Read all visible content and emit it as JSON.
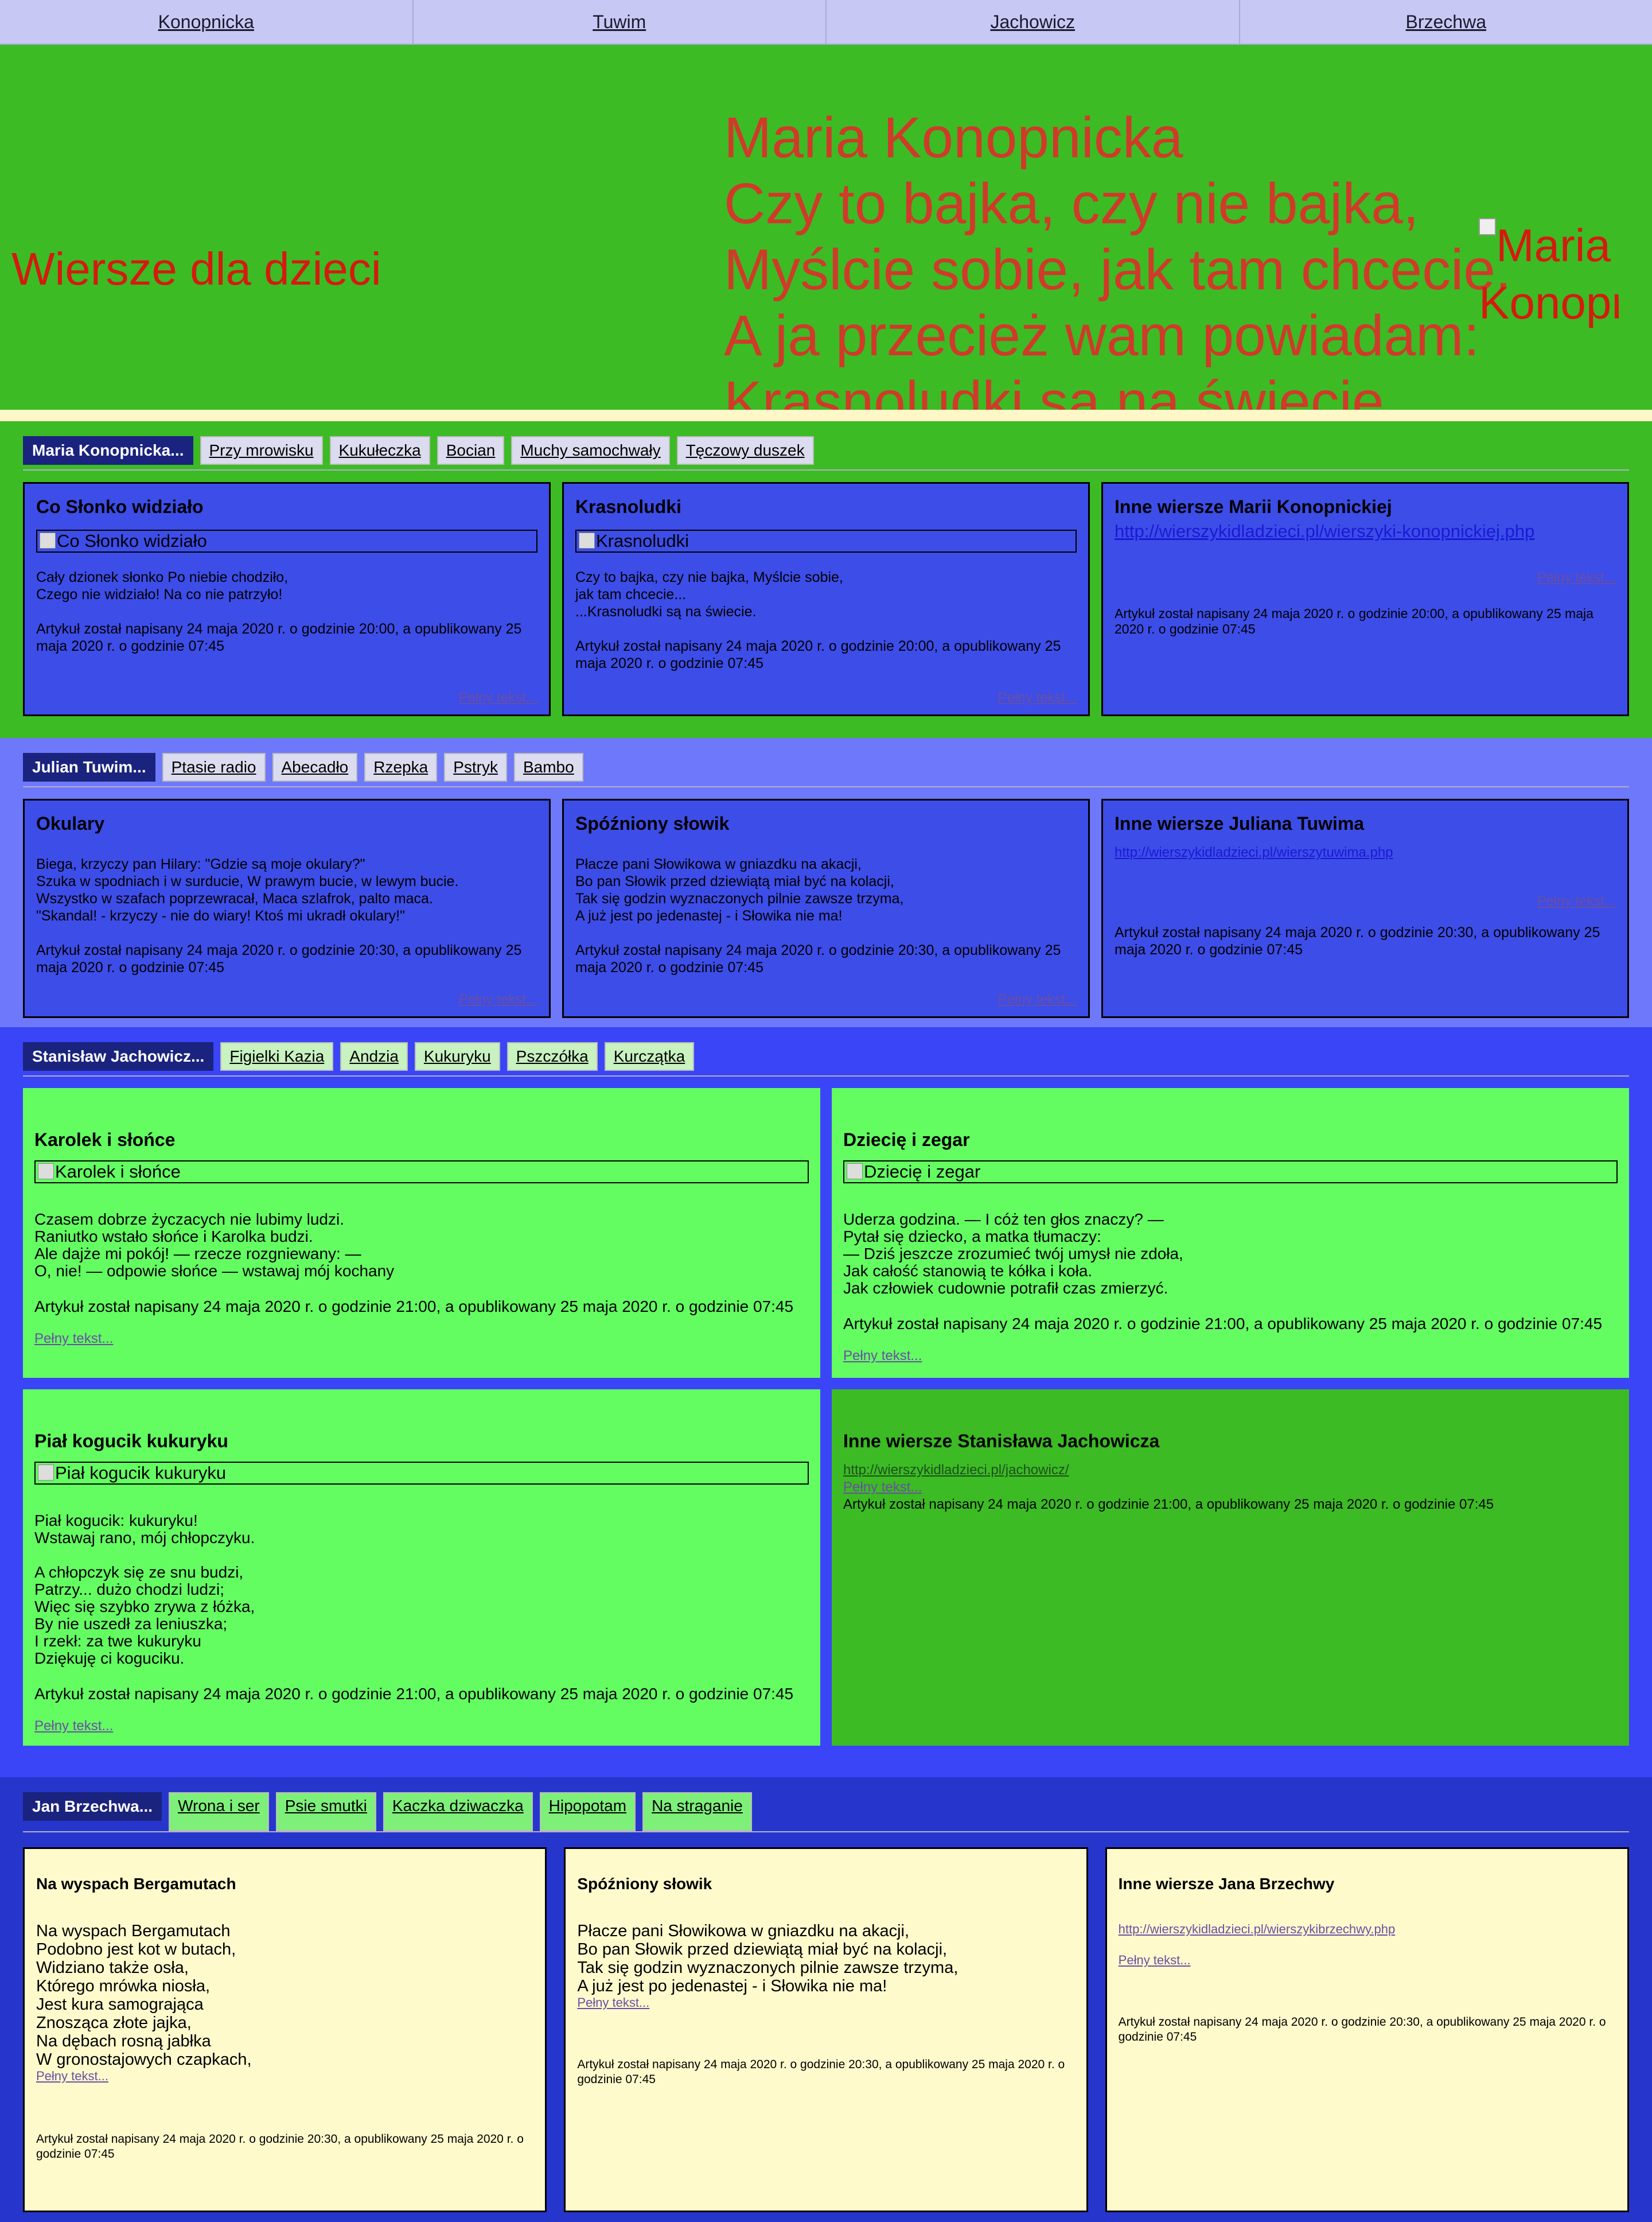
{
  "nav": [
    "Konopnicka",
    "Tuwim",
    "Jachowicz",
    "Brzechwa"
  ],
  "banner": {
    "site_title": "Wiersze dla dzieci",
    "quote": [
      "Maria Konopnicka",
      "Czy to bajka, czy nie bajka,",
      "Myślcie sobie, jak tam chcecie.",
      "A ja przecież wam powiadam:",
      "Krasnoludki są na świecie..."
    ],
    "portrait_alt": "Maria Konopnicka"
  },
  "konopnicka": {
    "author": "Maria Konopnicka...",
    "tabs": [
      "Przy mrowisku",
      "Kukułeczka",
      "Bocian",
      "Muchy samochwały",
      "Tęczowy duszek"
    ],
    "cards": [
      {
        "title": "Co Słonko widziało",
        "img_alt": "Co Słonko widziało",
        "text": [
          "Cały dzionek słonko Po niebie chodziło,",
          "Czego nie widziało! Na co nie patrzyło!"
        ],
        "meta": "Artykuł został napisany 24 maja 2020 r. o godzinie 20:00, a opublikowany 25 maja 2020 r. o godzinie 07:45",
        "more": "Pełny tekst..."
      },
      {
        "title": "Krasnoludki",
        "img_alt": "Krasnoludki",
        "text": [
          "Czy to bajka, czy nie bajka, Myślcie sobie,",
          "jak tam chcecie...",
          "...Krasnoludki są na świecie."
        ],
        "meta": "Artykuł został napisany 24 maja 2020 r. o godzinie 20:00, a opublikowany 25 maja 2020 r. o godzinie 07:45",
        "more": "Pełny tekst..."
      },
      {
        "title": "Inne wiersze Marii Konopnickiej",
        "link": "http://wierszykidladzieci.pl/wierszyki-konopnickiej.php",
        "more": "Pełny tekst...",
        "meta": "Artykuł został napisany 24 maja 2020 r. o godzinie 20:00, a opublikowany 25 maja 2020 r. o godzinie 07:45"
      }
    ]
  },
  "tuwim": {
    "author": "Julian Tuwim...",
    "tabs": [
      "Ptasie radio",
      "Abecadło",
      "Rzepka",
      "Pstryk",
      "Bambo"
    ],
    "cards": [
      {
        "title": "Okulary",
        "text": [
          "Biega, krzyczy pan Hilary: \"Gdzie są moje okulary?\"",
          "Szuka w spodniach i w surducie, W prawym bucie, w lewym bucie.",
          "Wszystko w szafach poprzewracał, Maca szlafrok, palto maca.",
          "\"Skandal! - krzyczy - nie do wiary! Ktoś mi ukradł okulary!\""
        ],
        "meta": "Artykuł został napisany 24 maja 2020 r. o godzinie 20:30, a opublikowany 25 maja 2020 r. o godzinie 07:45",
        "more": "Pełny tekst..."
      },
      {
        "title": "Spóźniony słowik",
        "text": [
          "Płacze pani Słowikowa w gniazdku na akacji,",
          "Bo pan Słowik przed dziewiątą miał być na kolacji,",
          "Tak się godzin wyznaczonych pilnie zawsze trzyma,",
          "A już jest po jedenastej - i Słowika nie ma!"
        ],
        "meta": "Artykuł został napisany 24 maja 2020 r. o godzinie 20:30, a opublikowany 25 maja 2020 r. o godzinie 07:45",
        "more": "Pełny tekst..."
      },
      {
        "title": "Inne wiersze Juliana Tuwima",
        "link": "http://wierszykidladzieci.pl/wierszytuwima.php",
        "more": "Pełny tekst...",
        "meta": "Artykuł został napisany 24 maja 2020 r. o godzinie 20:30, a opublikowany 25 maja 2020 r. o godzinie 07:45"
      }
    ]
  },
  "jachowicz": {
    "author": "Stanisław Jachowicz...",
    "tabs": [
      "Figielki Kazia",
      "Andzia",
      "Kukuryku",
      "Pszczółka",
      "Kurczątka"
    ],
    "cards": [
      {
        "title": "Karolek i słońce",
        "img_alt": "Karolek i słońce",
        "text": [
          "Czasem dobrze życzacych nie lubimy ludzi.",
          "Raniutko wstało słońce i Karolka budzi.",
          "Ale dajże mi pokój! — rzecze rozgniewany: —",
          "O, nie! — odpowie słońce — wstawaj mój kochany"
        ],
        "meta": "Artykuł został napisany 24 maja 2020 r. o godzinie 21:00, a opublikowany 25 maja 2020 r. o godzinie 07:45",
        "more": "Pełny tekst..."
      },
      {
        "title": "Dziecię i zegar",
        "img_alt": "Dziecię i zegar",
        "text": [
          "Uderza godzina. — I cóż ten głos znaczy? —",
          "Pytał się dziecko, a matka tłumaczy:",
          "— Dziś jeszcze zrozumieć twój umysł nie zdoła,",
          "Jak całość stanowią te kółka i koła.",
          "Jak człowiek cudownie potrafił czas zmierzyć."
        ],
        "meta": "Artykuł został napisany 24 maja 2020 r. o godzinie 21:00, a opublikowany 25 maja 2020 r. o godzinie 07:45",
        "more": "Pełny tekst..."
      },
      {
        "title": "Piał kogucik kukuryku",
        "img_alt": "Piał kogucik kukuryku",
        "text1": [
          "Piał kogucik: kukuryku!",
          "Wstawaj rano, mój chłopczyku."
        ],
        "text2": [
          "A chłopczyk się ze snu budzi,",
          "Patrzy... dużo chodzi ludzi;",
          "Więc się szybko zrywa z łóżka,",
          "By nie uszedł za leniuszka;",
          "I rzekł: za twe kukuryku",
          "Dziękuję ci koguciku."
        ],
        "meta": "Artykuł został napisany 24 maja 2020 r. o godzinie 21:00, a opublikowany 25 maja 2020 r. o godzinie 07:45",
        "more": "Pełny tekst..."
      },
      {
        "title": "Inne wiersze Stanisława Jachowicza",
        "link": "http://wierszykidladzieci.pl/jachowicz/",
        "more": "Pełny tekst...",
        "meta": "Artykuł został napisany 24 maja 2020 r. o godzinie 21:00, a opublikowany 25 maja 2020 r. o godzinie 07:45"
      }
    ]
  },
  "brzechwa": {
    "author": "Jan Brzechwa...",
    "tabs": [
      "Wrona i ser",
      "Psie smutki",
      "Kaczka dziwaczka",
      "Hipopotam",
      "Na straganie"
    ],
    "cards": [
      {
        "title": "Na wyspach Bergamutach",
        "text": [
          "Na wyspach Bergamutach",
          "Podobno jest kot w butach,",
          "Widziano także osła,",
          "Którego mrówka niosła,",
          "Jest kura samogrająca",
          "Znosząca złote jajka,",
          "Na dębach rosną jabłka",
          "W gronostajowych czapkach,"
        ],
        "more": "Pełny tekst...",
        "meta": "Artykuł został napisany 24 maja 2020 r. o godzinie 20:30, a opublikowany 25 maja 2020 r. o godzinie 07:45"
      },
      {
        "title": "Spóźniony słowik",
        "text": [
          "Płacze pani Słowikowa w gniazdku na akacji,",
          "Bo pan Słowik przed dziewiątą miał być na kolacji,",
          "Tak się godzin wyznaczonych pilnie zawsze trzyma,",
          "A już jest po jedenastej - i Słowika nie ma!"
        ],
        "more": "Pełny tekst...",
        "meta": "Artykuł został napisany 24 maja 2020 r. o godzinie 20:30, a opublikowany 25 maja 2020 r. o godzinie 07:45"
      },
      {
        "title": "Inne wiersze Jana Brzechwy",
        "link": "http://wierszykidladzieci.pl/wierszykibrzechwy.php",
        "more": "Pełny tekst...",
        "meta": "Artykuł został napisany 24 maja 2020 r. o godzinie 20:30, a opublikowany 25 maja 2020 r. o godzinie 07:45"
      }
    ]
  }
}
